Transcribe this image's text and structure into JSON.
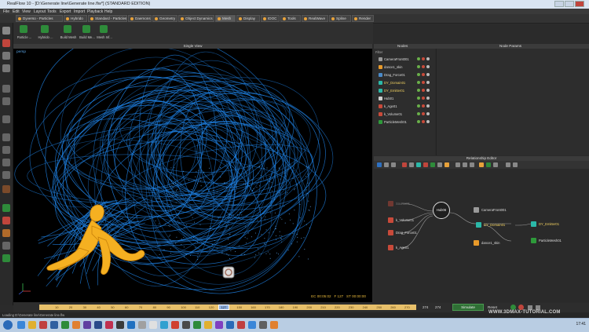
{
  "window": {
    "title": "RealFlow 10 - [D:\\Generate line\\Generate line.flw*] (STANDARD EDITION)"
  },
  "menu": [
    "File",
    "Edit",
    "View",
    "Layout",
    "Tools",
    "Export",
    "Import",
    "Playback",
    "Help"
  ],
  "shelf_tabs": [
    {
      "label": "Dyverso - Particles",
      "active": false
    },
    {
      "label": "Hybrido",
      "active": false
    },
    {
      "label": "Standard - Particles",
      "active": false
    },
    {
      "label": "Daemons",
      "active": false
    },
    {
      "label": "Geometry",
      "active": false
    },
    {
      "label": "Object Dynamics",
      "active": false
    },
    {
      "label": "Mesh",
      "active": true
    },
    {
      "label": "Display",
      "active": false
    },
    {
      "label": "IDOC",
      "active": false
    },
    {
      "label": "Tools",
      "active": false
    },
    {
      "label": "RealWave",
      "active": false
    },
    {
      "label": "Spline",
      "active": false
    },
    {
      "label": "Render",
      "active": false
    }
  ],
  "toolbar": [
    {
      "label": "Particle ...",
      "icon": "particle-mesh-icon"
    },
    {
      "label": "Hybrido ...",
      "icon": "hybrido-mesh-icon"
    },
    {
      "label": "Build Mesh",
      "icon": "build-mesh-icon"
    },
    {
      "label": "Build Me...",
      "icon": "build-mesh-icon"
    },
    {
      "label": "Mesh Inf...",
      "icon": "mesh-info-icon"
    }
  ],
  "viewport": {
    "header": "Single View",
    "camera": "persp",
    "ec": "EC 00:05:02",
    "frame": "F 127",
    "st": "ST 00:00:00"
  },
  "panels": {
    "nodes_title": "Nodes",
    "params_title": "Node Params",
    "relationship_title": "Relationship Editor"
  },
  "nodes": {
    "filter_label": "Filter",
    "items": [
      {
        "label": "CameraFront001",
        "color": "#9a9a9a"
      },
      {
        "label": "dance1_skin",
        "color": "#e89a2a"
      },
      {
        "label": "Drag_Force01",
        "color": "#4a8ac8"
      },
      {
        "label": "DY_Domain01",
        "color": "#2bb8a8"
      },
      {
        "label": "DY_Emitter01",
        "color": "#2bb8a8"
      },
      {
        "label": "Hub01",
        "color": "#cfcfcf"
      },
      {
        "label": "k_Age01",
        "color": "#c84a3a"
      },
      {
        "label": "k_Volume01",
        "color": "#c84a3a"
      },
      {
        "label": "ParticleMesh01",
        "color": "#2e9a3a"
      }
    ]
  },
  "graph": {
    "hub": "Hub06",
    "left_nodes": [
      {
        "label": "Source01",
        "color": "#c84a3a"
      },
      {
        "label": "k_Volume01",
        "color": "#c84a3a"
      },
      {
        "label": "Drag_Force01",
        "color": "#c84a3a"
      },
      {
        "label": "k_Age01",
        "color": "#c84a3a"
      }
    ],
    "right_nodes": [
      {
        "label": "CameraFront001",
        "color": "#9a9a9a"
      },
      {
        "label": "DY_Domain01",
        "color": "#2bb8a8"
      },
      {
        "label": "DY_Emitter01",
        "color": "#2bb8a8"
      },
      {
        "label": "dance1_skin",
        "color": "#e89a2a"
      },
      {
        "label": "ParticleMesh01",
        "color": "#2e9a3a"
      }
    ]
  },
  "timeline": {
    "ticks": [
      "10",
      "20",
      "30",
      "40",
      "50",
      "60",
      "70",
      "80",
      "90",
      "100",
      "110",
      "120",
      "140",
      "150",
      "160",
      "170",
      "180",
      "190",
      "200",
      "210",
      "220",
      "230",
      "240",
      "250",
      "260",
      "270"
    ],
    "current": "127",
    "end_a": "274",
    "end_b": "274",
    "simulate": "Simulate",
    "reset": "Reset"
  },
  "status": {
    "text": "Loading D:\\Generate line\\Generate line.flw"
  },
  "watermark": "WWW.3DMAX-TUTORIAL.COM",
  "taskbar": {
    "time": "17:41"
  },
  "colors": {
    "particles": "#1e7fe0",
    "figure": "#f5b021",
    "accent": "#e8c06a"
  }
}
